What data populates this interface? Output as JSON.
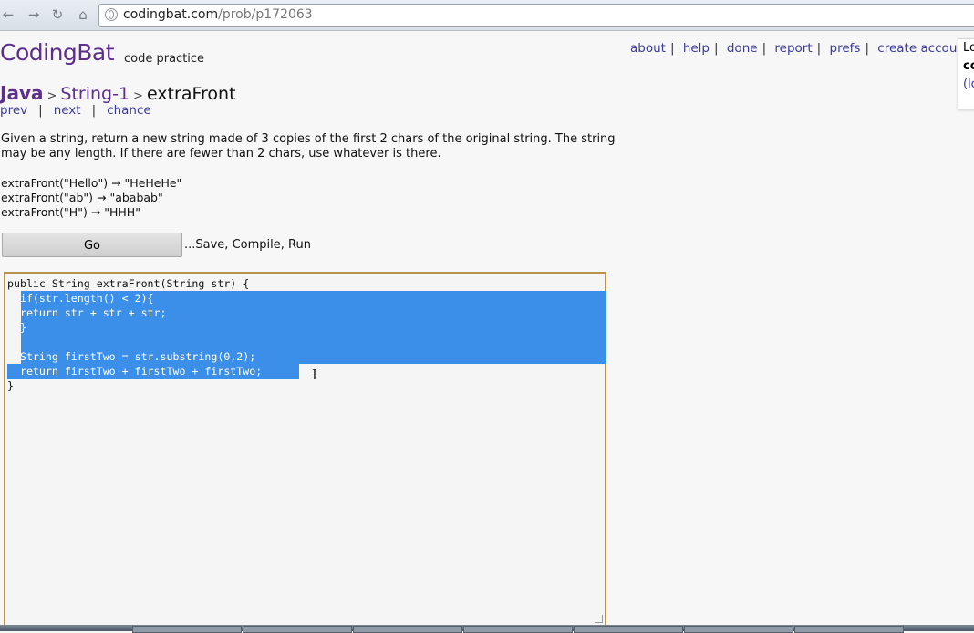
{
  "browser": {
    "url_host": "codingbat.com",
    "url_path": "/prob/p172063",
    "icons": [
      "back-icon",
      "forward-icon",
      "reload-icon",
      "home-icon",
      "globe-icon"
    ]
  },
  "header": {
    "logo": "CodingBat",
    "tagline": "code practice",
    "links": [
      "about",
      "help",
      "done",
      "report",
      "prefs",
      "create account"
    ]
  },
  "login_box": {
    "line1": "Lo",
    "line2": "co",
    "line3": "(lo"
  },
  "breadcrumb": {
    "language": "Java",
    "category": "String-1",
    "problem": "extraFront",
    "separator": ">"
  },
  "problem_nav": {
    "prev": "prev",
    "next": "next",
    "chance": "chance"
  },
  "problem": {
    "description": "Given a string, return a new string made of 3 copies of the first 2 chars of the original string. The string may be any length. If there are fewer than 2 chars, use whatever is there.",
    "examples": [
      "extraFront(\"Hello\") → \"HeHeHe\"",
      "extraFront(\"ab\") → \"ababab\"",
      "extraFront(\"H\") → \"HHH\""
    ]
  },
  "actions": {
    "go_label": "Go",
    "hint": "...Save, Compile, Run"
  },
  "editor": {
    "lines": [
      "public String extraFront(String str) {",
      "  if(str.length() < 2){",
      "  return str + str + str;",
      "  }",
      "",
      "  String firstTwo = str.substring(0,2);",
      "  return firstTwo + firstTwo + firstTwo;",
      "}"
    ],
    "selection_color": "#3b8fe8"
  },
  "colors": {
    "brand": "#5d2e8c",
    "link": "#3a3a9a",
    "editor_border": "#b9924c"
  }
}
